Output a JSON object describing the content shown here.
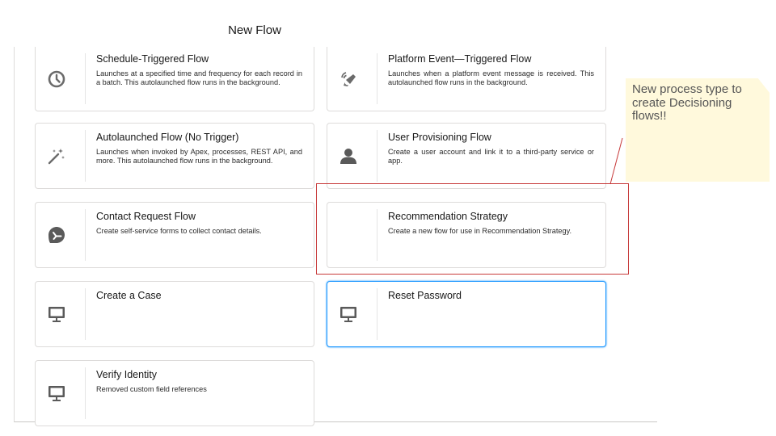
{
  "modal": {
    "title": "New Flow"
  },
  "cards": [
    {
      "title": "Schedule-Triggered Flow",
      "desc": "Launches at a specified time and frequency for each record in a batch. This autolaunched flow runs in the background.",
      "icon": "clock-icon"
    },
    {
      "title": "Platform Event—Triggered Flow",
      "desc": "Launches when a platform event message is received. This autolaunched flow runs in the background.",
      "icon": "platform-event-icon"
    },
    {
      "title": "Autolaunched Flow (No Trigger)",
      "desc": "Launches when invoked by Apex, processes, REST API, and more. This autolaunched flow runs in the background.",
      "icon": "magic-wand-icon"
    },
    {
      "title": "User Provisioning Flow",
      "desc": "Create a user account and link it to a third-party service or app.",
      "icon": "user-icon"
    },
    {
      "title": "Contact Request Flow",
      "desc": "Create self-service forms to collect contact details.",
      "icon": "contact-request-icon"
    },
    {
      "title": "Recommendation Strategy",
      "desc": "Create a new flow for use in Recommendation Strategy.",
      "icon": ""
    },
    {
      "title": "Create a Case",
      "desc": "",
      "icon": "desktop-icon"
    },
    {
      "title": "Reset Password",
      "desc": "",
      "icon": "desktop-icon",
      "selected": true
    },
    {
      "title": "Verify Identity",
      "desc": "Removed custom field references",
      "icon": "desktop-icon"
    }
  ],
  "annotation": {
    "note": "New process type to create Decisioning flows!!"
  },
  "colors": {
    "selected_border": "#1b96ff",
    "highlight_box": "#c73a3a",
    "sticky_note": "#fff9dc",
    "icon": "#6b6b6b"
  }
}
